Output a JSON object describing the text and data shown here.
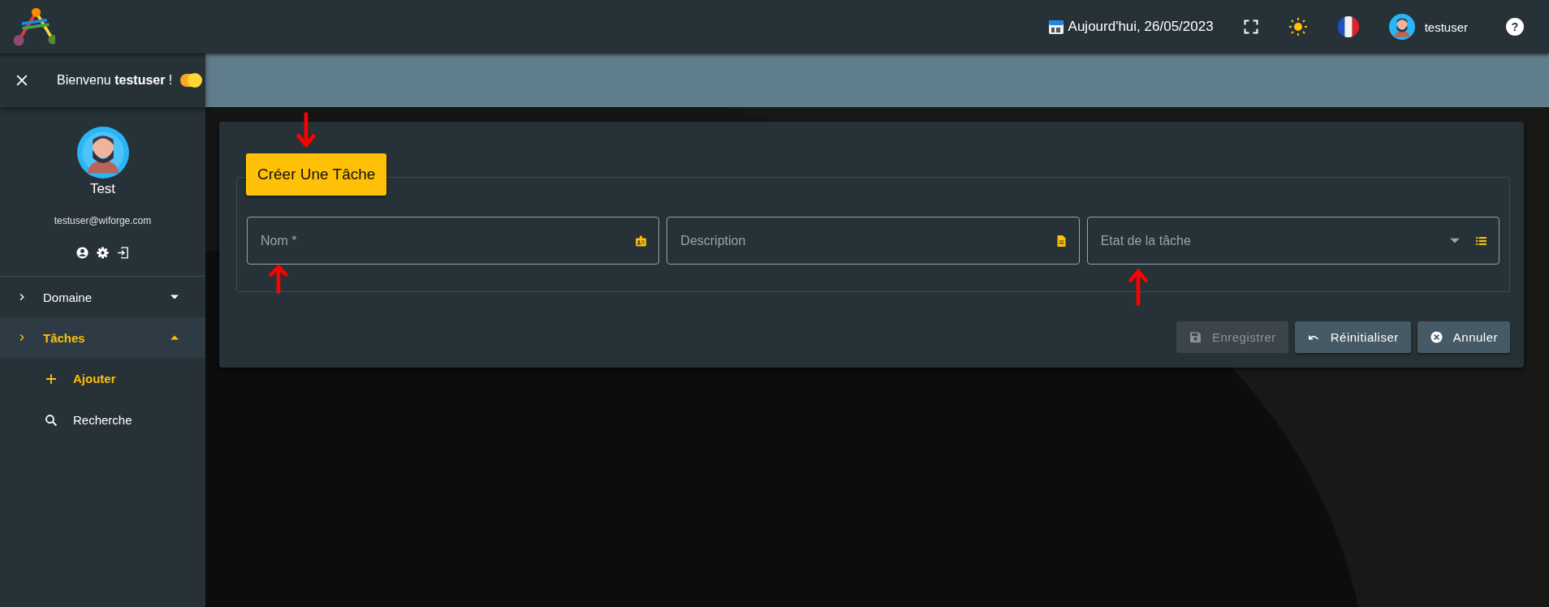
{
  "header": {
    "date": "Aujourd'hui, 26/05/2023",
    "username": "testuser",
    "help": "?"
  },
  "sidebar": {
    "greeting": "Bienvenu **testuser** !",
    "toggle_on": true,
    "profile": {
      "name": "Test",
      "email": "testuser@wiforge.com"
    },
    "menu": [
      {
        "label": "Domaine",
        "expanded": false,
        "selected": false
      },
      {
        "label": "Tâches",
        "expanded": true,
        "selected": true,
        "children": [
          {
            "kind": "add",
            "label": "Ajouter",
            "selected": true
          },
          {
            "kind": "search",
            "label": "Recherche",
            "selected": false
          }
        ]
      }
    ]
  },
  "form": {
    "title": "Créer Une Tâche",
    "fields": [
      {
        "kind": "badge",
        "placeholder": "Nom *"
      },
      {
        "kind": "document",
        "placeholder": "Description"
      },
      {
        "kind": "select",
        "placeholder": "Etat de la tâche"
      }
    ],
    "buttons": [
      {
        "kind": "save",
        "label": "Enregistrer",
        "disabled": true
      },
      {
        "kind": "reset",
        "label": "Réinitialiser",
        "disabled": false
      },
      {
        "kind": "cancel",
        "label": "Annuler",
        "disabled": false
      }
    ]
  }
}
